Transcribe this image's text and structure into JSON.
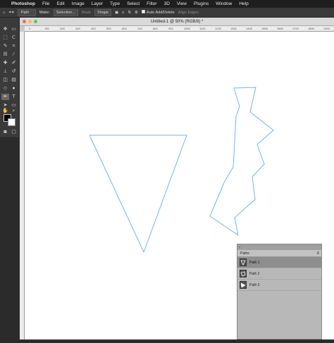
{
  "menubar": {
    "apple": "",
    "app_name": "Photoshop",
    "items": [
      "File",
      "Edit",
      "Image",
      "Layer",
      "Type",
      "Select",
      "Filter",
      "3D",
      "View",
      "Plugins",
      "Window",
      "Help"
    ]
  },
  "options": {
    "mode_value": "Path",
    "make_label": "Make:",
    "selection_label": "Selection...",
    "mask_label": "Mask",
    "shape_label": "Shape",
    "auto_add_delete_label": "Auto Add/Delete",
    "align_edges_label": "Align Edges"
  },
  "document": {
    "title": "Untitled-1 @ 50% (RGB/8) *",
    "ruler_ticks": [
      "0",
      "100",
      "200",
      "300",
      "400",
      "500",
      "600",
      "700",
      "800",
      "900",
      "1000",
      "1100",
      "1200",
      "1300",
      "1400",
      "1500",
      "1600",
      "1700",
      "1800",
      "1900"
    ]
  },
  "paths_panel": {
    "tab_label": "Paths",
    "menu_icon": "panel-menu-icon",
    "items": [
      {
        "label": "Path 1",
        "selected": true
      },
      {
        "label": "Path 2",
        "selected": false
      },
      {
        "label": "Path 3",
        "selected": false
      }
    ]
  },
  "colors": {
    "path_stroke": "#6fb7e6",
    "foreground": "#000000",
    "background": "#ffffff"
  }
}
